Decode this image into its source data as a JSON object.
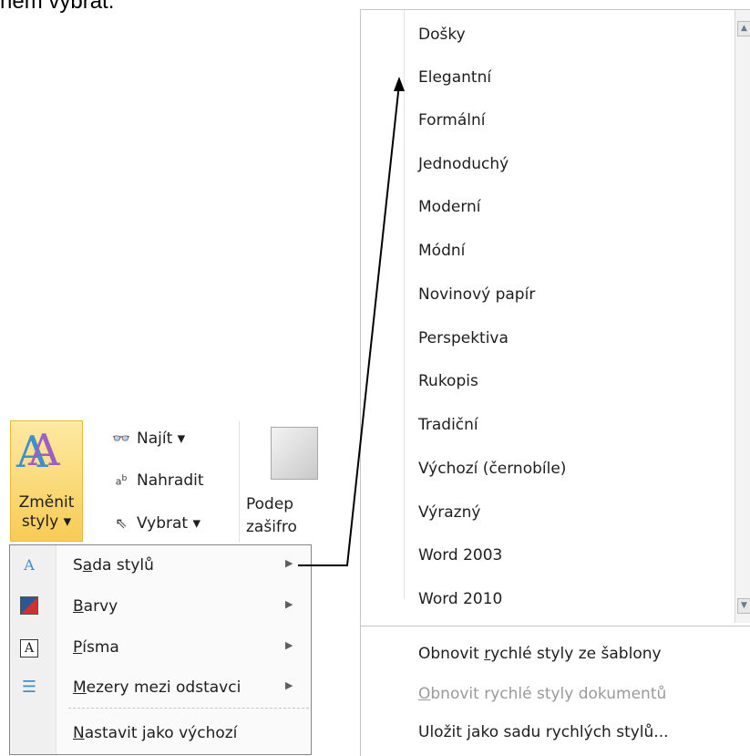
{
  "top_text": "ném vybrat.",
  "styles_menu": {
    "items": [
      "Došky",
      "Elegantní",
      "Formální",
      "Jednoduchý",
      "Moderní",
      "Módní",
      "Novinový papír",
      "Perspektiva",
      "Rukopis",
      "Tradiční",
      "Výchozí (černobíle)",
      "Výrazný",
      "Word 2003",
      "Word 2010"
    ],
    "scroll_up": "▲",
    "scroll_down": "▼",
    "commands": [
      {
        "pre": "Obnovit ",
        "acc": "r",
        "post": "ychlé styly ze šablony"
      },
      {
        "pre": "",
        "acc": "O",
        "post": "bnovit rychlé styly dokumentů"
      },
      {
        "pre": "Uložit ",
        "acc": "j",
        "post": "ako sadu rychlých stylů..."
      }
    ]
  },
  "ribbon": {
    "change_styles_line1": "Změnit",
    "change_styles_line2": "styly ▾",
    "find_label": "Najít ▾",
    "replace_label": "Nahradit",
    "select_label": "Vybrat ▾",
    "sign_line1": "Podep",
    "sign_line2": "zašifro",
    "icons": {
      "find": "binoculars-icon",
      "replace": "replace-icon",
      "select": "cursor-icon",
      "sign": "signature-icon"
    }
  },
  "dropdown": {
    "items": [
      {
        "pre": "S",
        "acc": "a",
        "post": "da stylů",
        "icon": "style-set-icon"
      },
      {
        "pre": "",
        "acc": "B",
        "post": "arvy",
        "icon": "colors-icon"
      },
      {
        "pre": "",
        "acc": "P",
        "post": "ísma",
        "icon": "fonts-icon"
      },
      {
        "pre": "",
        "acc": "M",
        "post": "ezery mezi odstavci",
        "icon": "paragraph-spacing-icon"
      },
      {
        "pre": "",
        "acc": "N",
        "post": "astavit jako výchozí",
        "icon": ""
      }
    ],
    "submenu_arrow": "▶"
  },
  "colors": {
    "accent_border": "#e6bb3c",
    "accent_fill": "#f8cc55",
    "disabled_text": "#9a9a9a"
  }
}
